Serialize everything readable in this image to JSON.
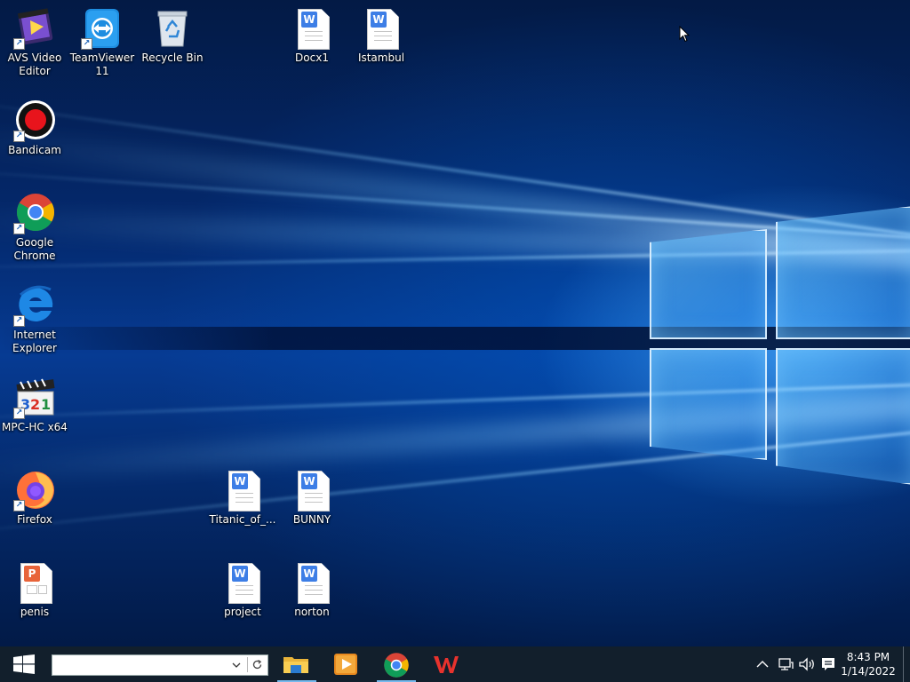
{
  "desktop_icons": {
    "avs": {
      "label": "AVS Video Editor"
    },
    "teamviewer": {
      "label": "TeamViewer 11"
    },
    "recycle": {
      "label": "Recycle Bin"
    },
    "docx1": {
      "label": "Docx1"
    },
    "istambul": {
      "label": "Istambul"
    },
    "bandicam": {
      "label": "Bandicam"
    },
    "chrome": {
      "label": "Google Chrome"
    },
    "ie": {
      "label": "Internet Explorer"
    },
    "mpc": {
      "label": "MPC-HC x64"
    },
    "firefox": {
      "label": "Firefox"
    },
    "titanic": {
      "label": "Titanic_of_..."
    },
    "bunny": {
      "label": "BUNNY"
    },
    "penis": {
      "label": "penis"
    },
    "project": {
      "label": "project"
    },
    "norton": {
      "label": "norton"
    }
  },
  "taskbar": {
    "search_value": "",
    "pinned": [
      "file-explorer",
      "video-player",
      "google-chrome",
      "wps-office"
    ],
    "clock_time": "8:43 PM",
    "clock_date": "1/14/2022"
  },
  "colors": {
    "taskbar": "#121f2c",
    "active_indicator": "#76b9ed"
  }
}
